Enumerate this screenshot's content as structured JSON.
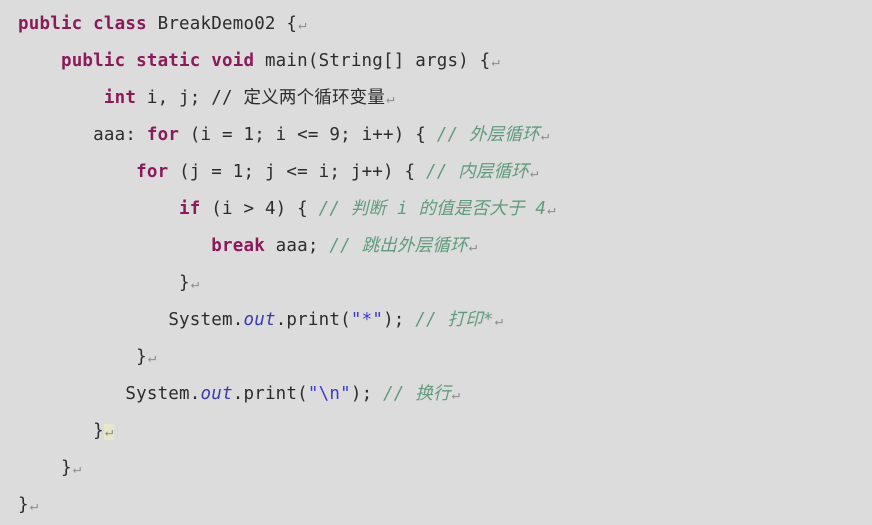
{
  "editor": {
    "background_color": "#dcdcdc",
    "language": "Java",
    "class_name": "BreakDemo02",
    "colors": {
      "keyword": "#8b1a5b",
      "plain": "#2c2c2c",
      "field": "#3b3bb0",
      "string": "#3a3ad0",
      "comment": "#5f9b7c",
      "return_mark": "#8d8d8d"
    },
    "return_mark_glyph": "↵"
  },
  "lines": [
    {
      "number": 1,
      "indent": "",
      "tokens": [
        {
          "kind": "keyword",
          "text": "public class "
        },
        {
          "kind": "plain",
          "text": "BreakDemo02 {"
        },
        {
          "kind": "return",
          "text": "↵"
        }
      ]
    },
    {
      "number": 2,
      "indent": "    ",
      "tokens": [
        {
          "kind": "keyword",
          "text": "public static void "
        },
        {
          "kind": "plain",
          "text": "main(String[] args) {"
        },
        {
          "kind": "return",
          "text": "↵"
        }
      ]
    },
    {
      "number": 3,
      "indent": "        ",
      "tokens": [
        {
          "kind": "keyword",
          "text": "int"
        },
        {
          "kind": "plain",
          "text": " i, j; // 定义两个循环变量"
        },
        {
          "kind": "return",
          "text": "↵"
        }
      ]
    },
    {
      "number": 4,
      "indent": "       ",
      "tokens": [
        {
          "kind": "plain",
          "text": "aaa: "
        },
        {
          "kind": "keyword",
          "text": "for"
        },
        {
          "kind": "plain",
          "text": " (i = 1; i <= 9; i++) {"
        },
        {
          "kind": "comment",
          "text": " // 外层循环"
        },
        {
          "kind": "return",
          "text": "↵"
        }
      ]
    },
    {
      "number": 5,
      "indent": "           ",
      "tokens": [
        {
          "kind": "keyword",
          "text": "for"
        },
        {
          "kind": "plain",
          "text": " (j = 1; j <= i; j++) {"
        },
        {
          "kind": "comment",
          "text": " // 内层循环"
        },
        {
          "kind": "return",
          "text": "↵"
        }
      ]
    },
    {
      "number": 6,
      "indent": "               ",
      "tokens": [
        {
          "kind": "keyword",
          "text": "if"
        },
        {
          "kind": "plain",
          "text": " (i > 4) {"
        },
        {
          "kind": "comment",
          "text": " // 判断 i 的值是否大于 4"
        },
        {
          "kind": "return",
          "text": "↵"
        }
      ]
    },
    {
      "number": 7,
      "indent": "                  ",
      "tokens": [
        {
          "kind": "keyword",
          "text": "break"
        },
        {
          "kind": "plain",
          "text": " aaa;"
        },
        {
          "kind": "comment",
          "text": " // 跳出外层循环"
        },
        {
          "kind": "return",
          "text": "↵"
        }
      ]
    },
    {
      "number": 8,
      "indent": "               ",
      "tokens": [
        {
          "kind": "plain",
          "text": "}"
        },
        {
          "kind": "return",
          "text": "↵"
        }
      ]
    },
    {
      "number": 9,
      "indent": "              ",
      "tokens": [
        {
          "kind": "plain",
          "text": "System."
        },
        {
          "kind": "field",
          "text": "out"
        },
        {
          "kind": "plain",
          "text": ".print("
        },
        {
          "kind": "string",
          "text": "\"*\""
        },
        {
          "kind": "plain",
          "text": ");"
        },
        {
          "kind": "comment",
          "text": " // 打印*"
        },
        {
          "kind": "return",
          "text": "↵"
        }
      ]
    },
    {
      "number": 10,
      "indent": "           ",
      "tokens": [
        {
          "kind": "plain",
          "text": "}"
        },
        {
          "kind": "return",
          "text": "↵"
        }
      ]
    },
    {
      "number": 11,
      "indent": "          ",
      "tokens": [
        {
          "kind": "plain",
          "text": "System."
        },
        {
          "kind": "field",
          "text": "out"
        },
        {
          "kind": "plain",
          "text": ".print("
        },
        {
          "kind": "string",
          "text": "\"\\n\""
        },
        {
          "kind": "plain",
          "text": ");"
        },
        {
          "kind": "comment",
          "text": " // 换行"
        },
        {
          "kind": "return",
          "text": "↵"
        }
      ]
    },
    {
      "number": 12,
      "indent": "       ",
      "tokens": [
        {
          "kind": "plain",
          "text": "}"
        },
        {
          "kind": "return-highlight",
          "text": "↵"
        }
      ]
    },
    {
      "number": 13,
      "indent": "    ",
      "tokens": [
        {
          "kind": "plain",
          "text": "}"
        },
        {
          "kind": "return",
          "text": "↵"
        }
      ]
    },
    {
      "number": 14,
      "indent": "",
      "tokens": [
        {
          "kind": "plain",
          "text": "}"
        },
        {
          "kind": "return",
          "text": "↵"
        }
      ]
    }
  ]
}
